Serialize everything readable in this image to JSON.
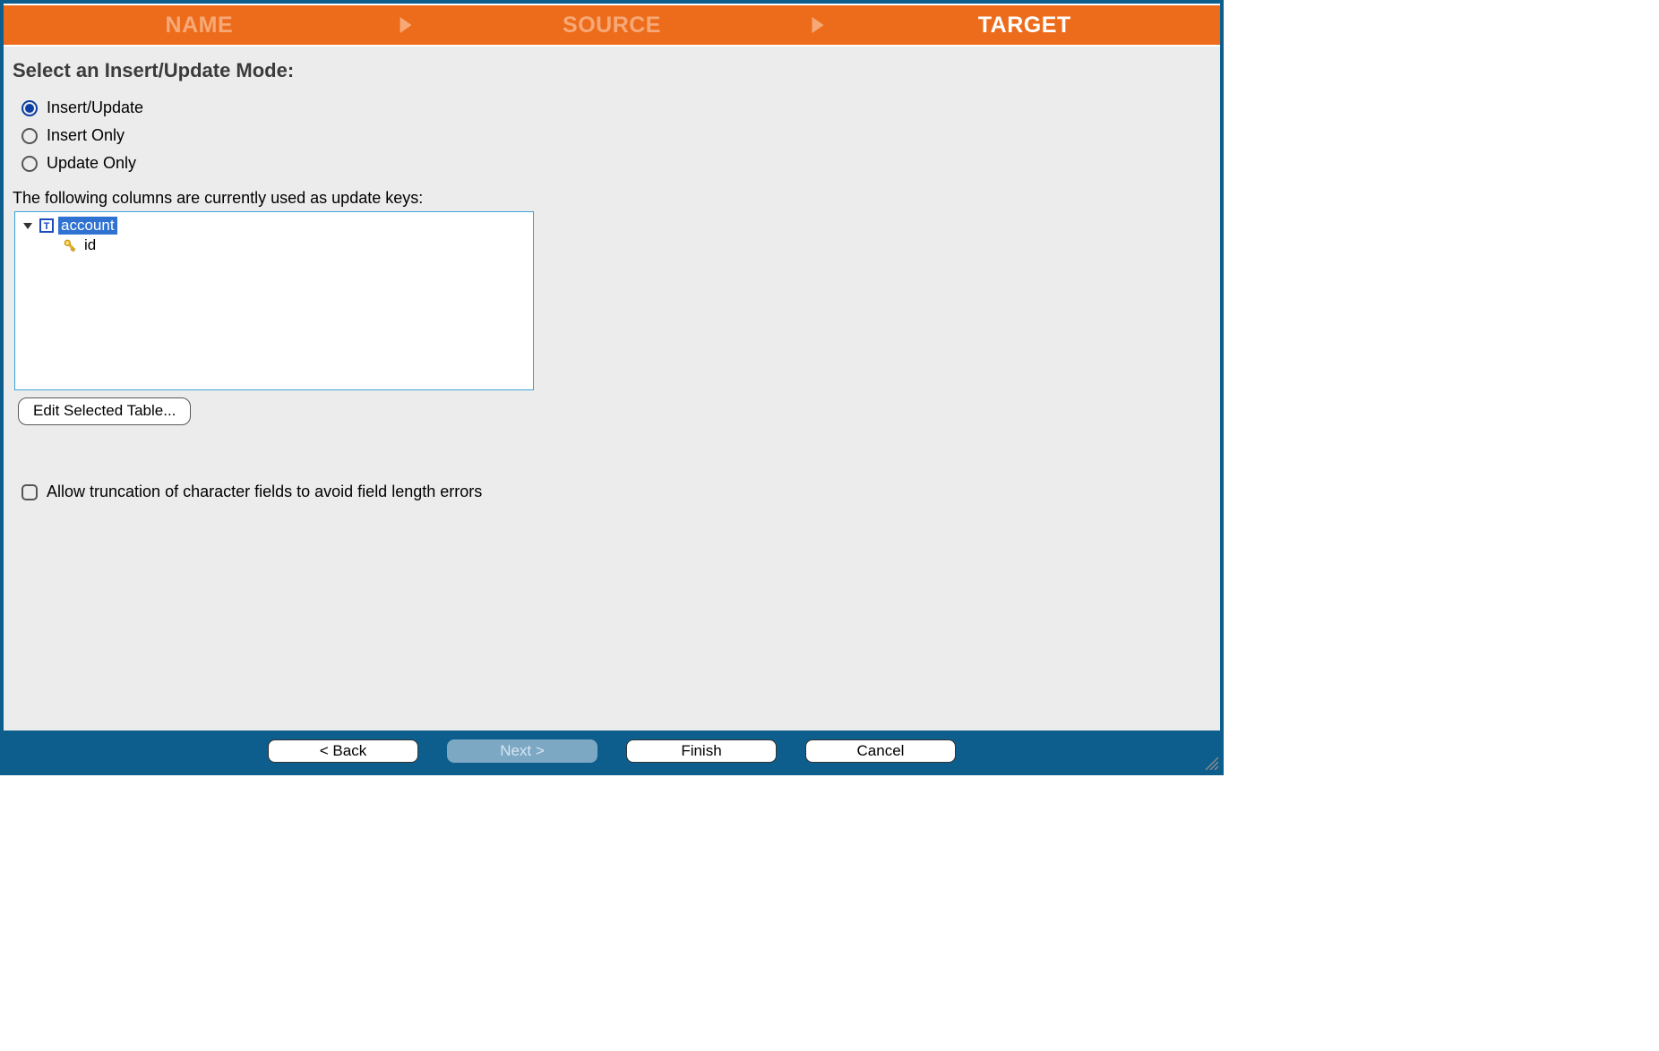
{
  "steps": {
    "name": "NAME",
    "source": "SOURCE",
    "target": "TARGET",
    "active": "target"
  },
  "main": {
    "title": "Select an Insert/Update Mode:",
    "radios": [
      {
        "key": "insert_update",
        "label": "Insert/Update",
        "selected": true
      },
      {
        "key": "insert_only",
        "label": "Insert Only",
        "selected": false
      },
      {
        "key": "update_only",
        "label": "Update Only",
        "selected": false
      }
    ],
    "keysLabel": "The following columns are currently used as update keys:",
    "tree": {
      "root": {
        "label": "account",
        "selected": true,
        "expanded": true
      },
      "children": [
        {
          "label": "id",
          "kind": "key"
        }
      ]
    },
    "editButton": "Edit Selected Table...",
    "truncate": {
      "label": "Allow truncation of character fields to avoid field length errors",
      "checked": false
    }
  },
  "footer": {
    "back": "< Back",
    "next": "Next >",
    "finish": "Finish",
    "cancel": "Cancel",
    "nextEnabled": false
  }
}
